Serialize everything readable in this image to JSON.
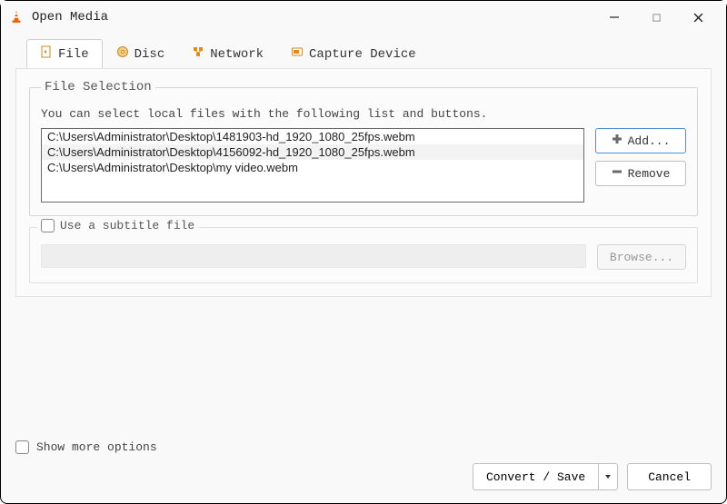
{
  "window": {
    "title": "Open Media"
  },
  "tabs": [
    {
      "label": "File"
    },
    {
      "label": "Disc"
    },
    {
      "label": "Network"
    },
    {
      "label": "Capture Device"
    }
  ],
  "fileSelection": {
    "legend": "File Selection",
    "hint": "You can select local files with the following list and buttons.",
    "files": [
      "C:\\Users\\Administrator\\Desktop\\1481903-hd_1920_1080_25fps.webm",
      "C:\\Users\\Administrator\\Desktop\\4156092-hd_1920_1080_25fps.webm",
      "C:\\Users\\Administrator\\Desktop\\my video.webm"
    ],
    "addLabel": "Add...",
    "removeLabel": "Remove"
  },
  "subtitle": {
    "checkboxLabel": "Use a subtitle file",
    "browseLabel": "Browse..."
  },
  "footer": {
    "moreOptions": "Show more options",
    "convertSave": "Convert / Save",
    "cancel": "Cancel"
  }
}
